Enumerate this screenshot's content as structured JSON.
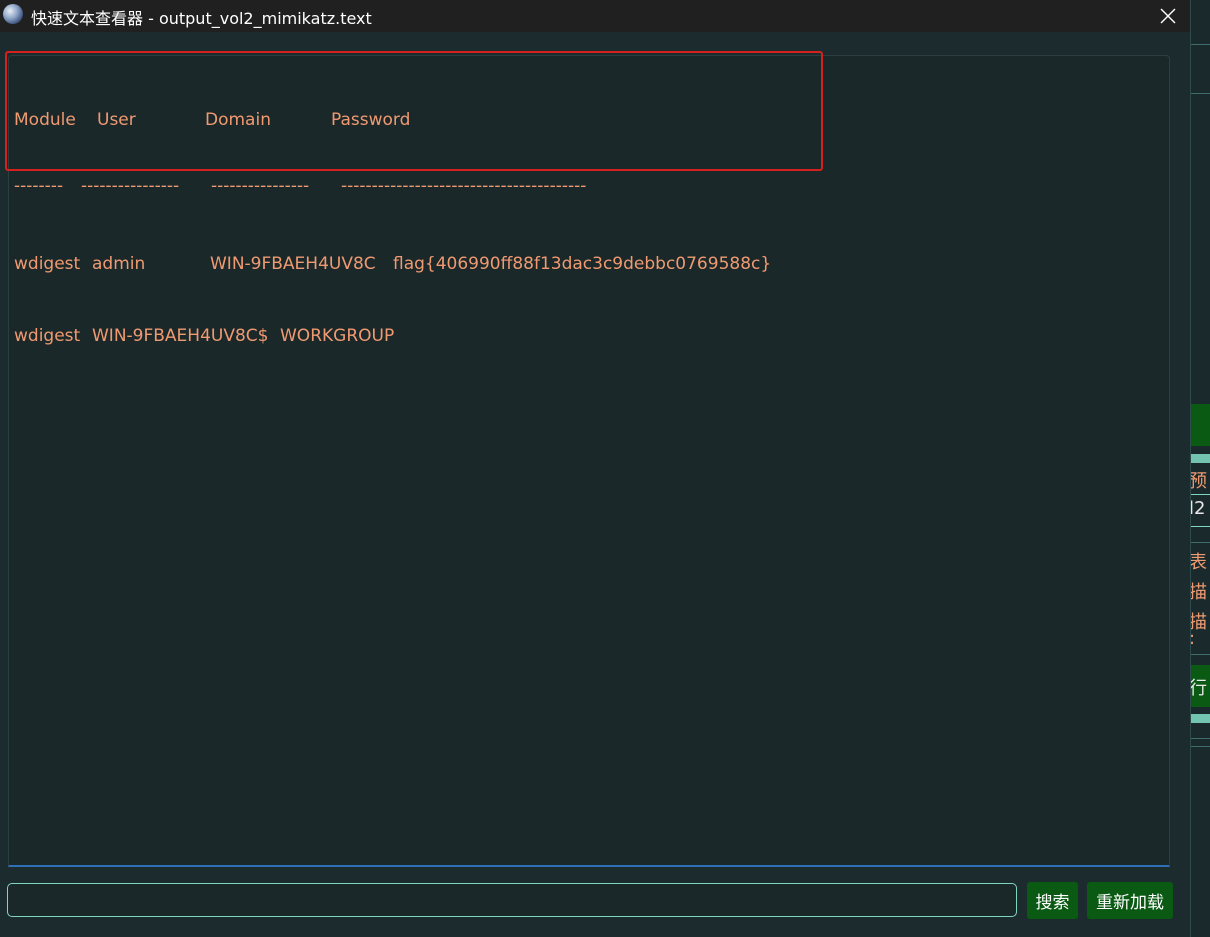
{
  "window": {
    "title": "快速文本查看器 - output_vol2_mimikatz.text",
    "icon": "globe-icon"
  },
  "content": {
    "header": {
      "module": "Module",
      "user": "User",
      "domain": "Domain",
      "password": "Password"
    },
    "separator": {
      "module": "--------",
      "user": "----------------",
      "domain": "----------------",
      "password": "----------------------------------------"
    },
    "rows": [
      {
        "module": "wdigest",
        "user": "admin",
        "domain": "WIN-9FBAEH4UV8C",
        "password": "flag{406990ff88f13dac3c9debbc0769588c}"
      },
      {
        "module": "wdigest",
        "user": "WIN-9FBAEH4UV8C$",
        "domain": "WORKGROUP",
        "password": ""
      }
    ]
  },
  "search": {
    "value": "",
    "placeholder": ""
  },
  "buttons": {
    "search_label": "搜索",
    "reload_label": "重新加载"
  },
  "background_window": {
    "fragments": [
      "预",
      "l2",
      "表",
      "描",
      "描",
      ":",
      "行"
    ]
  },
  "colors": {
    "text": "#f09a72",
    "button_bg": "#0a5a13",
    "highlight_border": "#d6201d",
    "input_border": "#7fd6bf",
    "focus_underline": "#2f6fb5"
  }
}
